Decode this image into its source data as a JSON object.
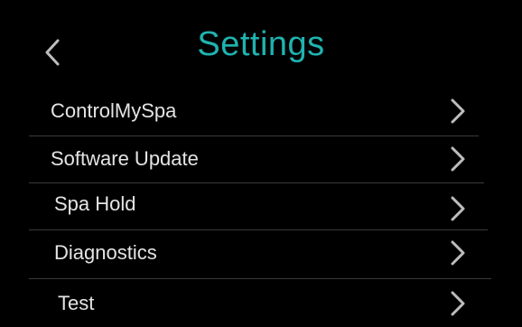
{
  "header": {
    "title": "Settings",
    "back_icon": "chevron-left-icon"
  },
  "colors": {
    "background": "#000000",
    "title_accent": "#1fb3b0",
    "label_text": "#e4e4e4",
    "divider": "#3a3a3a",
    "chevron": "#bdbdbd"
  },
  "menu": {
    "items": [
      {
        "label": "ControlMySpa",
        "icon": "chevron-right-icon"
      },
      {
        "label": "Software Update",
        "icon": "chevron-right-icon"
      },
      {
        "label": "Spa Hold",
        "icon": "chevron-right-icon"
      },
      {
        "label": "Diagnostics",
        "icon": "chevron-right-icon"
      },
      {
        "label": "Test",
        "icon": "chevron-right-icon"
      }
    ]
  }
}
